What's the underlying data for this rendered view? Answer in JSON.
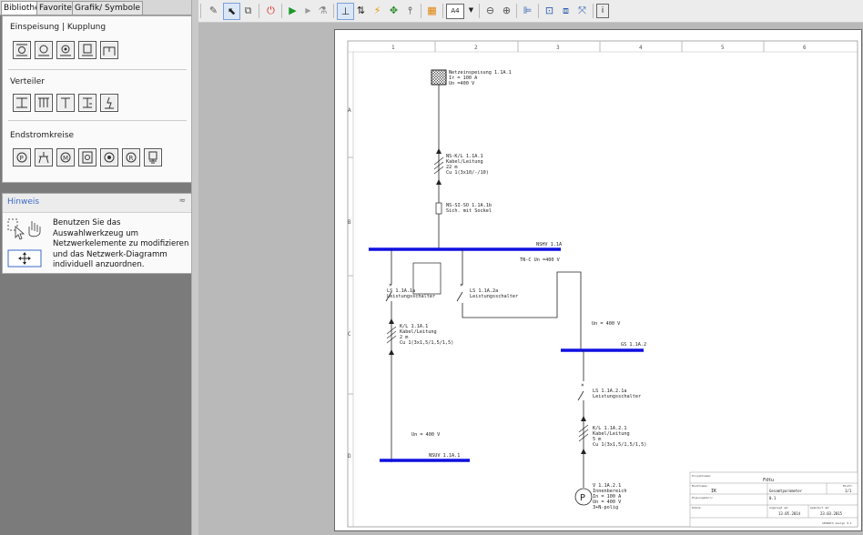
{
  "tabs": [
    "Bibliothek",
    "Favoriten",
    "Grafik/ Symbole"
  ],
  "library": {
    "sections": [
      {
        "title": "Einspeisung | Kupplung"
      },
      {
        "title": "Verteiler"
      },
      {
        "title": "Endstromkreise"
      }
    ]
  },
  "hint": {
    "title": "Hinweis",
    "collapse": "≈",
    "text": "Benutzen Sie das Auswahlwerkzeug um Netzwerkelemente zu modifizieren und das Netzwerk-Diagramm individuell anzuordnen."
  },
  "toolbar": {
    "zoom_label": "A4"
  },
  "drawing": {
    "cols": [
      "1",
      "2",
      "3",
      "4",
      "5",
      "6"
    ],
    "rows": [
      "A",
      "B",
      "C",
      "D"
    ],
    "feed": {
      "line1": "Netzeinspeisung 1.1A.1",
      "line2": "Ir  = 100  A",
      "line3": "Un  =400  V"
    },
    "cable1": {
      "line1": "NS-K/L 1.1A.1",
      "line2": "Kabel/Leitung",
      "line3": "22 m",
      "line4": "Cu 1(3x10/-/10)"
    },
    "fuse": {
      "line1": "NS-SI-SO 1.1A.1b",
      "line2": "Sich. mit Sockel"
    },
    "nshv": {
      "name": "NSHV 1.1A",
      "net": "TN-C  Un  =400  V"
    },
    "ls1": {
      "line1": "LS 1.1A.1a",
      "line2": "Leistungsschalter"
    },
    "ls2": {
      "line1": "LS 1.1A.2a",
      "line2": "Leistungsschalter"
    },
    "cable2": {
      "line1": "K/L 1.1A.1",
      "line2": "Kabel/Leitung",
      "line3": "2 m",
      "line4": "Cu 1(3x1,5/1,5/1,5)"
    },
    "un_left": "Un  = 400  V",
    "nsuv": "NSUV 1.1A.1",
    "un_right": "Un  = 400  V",
    "gs": "GS 1.1A.2",
    "ls3": {
      "line1": "LS 1.1A.2.1a",
      "line2": "Leistungsschalter"
    },
    "cable3": {
      "line1": "K/L 1.1A.2.1",
      "line2": "Kabel/Leitung",
      "line3": "5 m",
      "line4": "Cu 1(3x1,5/1,5/1,5)"
    },
    "consumer": {
      "symbol": "P",
      "line1": "V 1.1A.2.1",
      "line2": "Innenbereich",
      "line3": "In  = 100  A",
      "line4": "Un  = 400  V",
      "line5": "3+N-polig"
    },
    "titleblock": {
      "project_label": "Projektname:",
      "project": "Fdtu",
      "sheet_label": "Blattname:",
      "sheet_left": "IK",
      "sheet_right": "Gesamtparameter",
      "page_label": "Blatt:",
      "page": "1/1",
      "plan_label": "Planungsbüro:",
      "plan_value": "0.1",
      "date_label": "Datum:",
      "created_label": "Angelegt am:",
      "created": "13.05.2014",
      "changed_label": "Geändert am:",
      "changed": "23.03.2015",
      "footer": "SIMARIS design 9.1"
    }
  }
}
